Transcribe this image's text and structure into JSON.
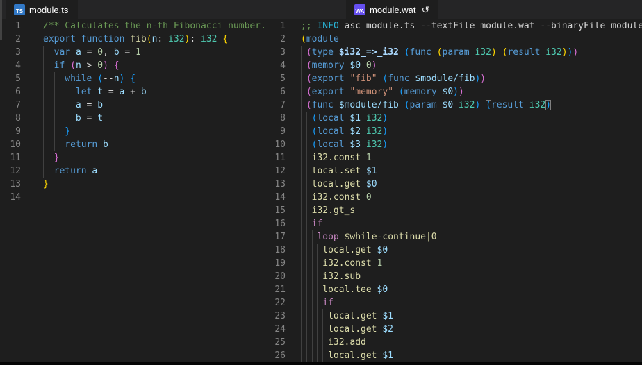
{
  "tabs": {
    "left": {
      "label": "module.ts",
      "icon_text": "TS",
      "icon_color": "#3178c6"
    },
    "right": {
      "label": "module.wat",
      "icon_text": "WA",
      "icon_color": "#654ff0",
      "reload_icon": "↺"
    }
  },
  "palette": {
    "kw": "#569cd6",
    "ctrl": "#c586c0",
    "fn": "#dcdcaa",
    "var": "#9cdcfe",
    "ent": "#abd9ff",
    "type": "#4ec9b0",
    "num": "#b5cea8",
    "str": "#ce9178",
    "cmt": "#6a9955",
    "info": "#29b8db",
    "txt": "#d4d4d4",
    "b1": "#ffd700",
    "b2": "#da70d6",
    "b3": "#179fff",
    "b3m": "#179fff",
    "line_number": "#858585",
    "editor_bg": "#1e1e1e",
    "tabbar_bg": "#252526"
  },
  "left_editor": {
    "language": "typescript",
    "lines": [
      {
        "n": 1,
        "ind": 0,
        "guides": [],
        "tokens": [
          [
            "cmt",
            "/** Calculates the n-th Fibonacci number."
          ]
        ]
      },
      {
        "n": 2,
        "ind": 0,
        "guides": [],
        "tokens": [
          [
            "kw",
            "export"
          ],
          [
            "txt",
            " "
          ],
          [
            "kw",
            "function"
          ],
          [
            "txt",
            " "
          ],
          [
            "fn",
            "fib"
          ],
          [
            "b1",
            "("
          ],
          [
            "var",
            "n"
          ],
          [
            "txt",
            ": "
          ],
          [
            "type",
            "i32"
          ],
          [
            "b1",
            ")"
          ],
          [
            "txt",
            ": "
          ],
          [
            "type",
            "i32"
          ],
          [
            "txt",
            " "
          ],
          [
            "b1",
            "{"
          ]
        ]
      },
      {
        "n": 3,
        "ind": 2,
        "guides": [
          0
        ],
        "tokens": [
          [
            "kw",
            "var"
          ],
          [
            "txt",
            " "
          ],
          [
            "var",
            "a"
          ],
          [
            "txt",
            " = "
          ],
          [
            "num",
            "0"
          ],
          [
            "txt",
            ", "
          ],
          [
            "var",
            "b"
          ],
          [
            "txt",
            " = "
          ],
          [
            "num",
            "1"
          ]
        ]
      },
      {
        "n": 4,
        "ind": 2,
        "guides": [
          0
        ],
        "tokens": [
          [
            "kw",
            "if"
          ],
          [
            "txt",
            " "
          ],
          [
            "b2",
            "("
          ],
          [
            "var",
            "n"
          ],
          [
            "txt",
            " > "
          ],
          [
            "num",
            "0"
          ],
          [
            "b2",
            ")"
          ],
          [
            "txt",
            " "
          ],
          [
            "b2",
            "{"
          ]
        ]
      },
      {
        "n": 5,
        "ind": 4,
        "guides": [
          0,
          2
        ],
        "tokens": [
          [
            "kw",
            "while"
          ],
          [
            "txt",
            " "
          ],
          [
            "b3",
            "("
          ],
          [
            "txt",
            "--"
          ],
          [
            "var",
            "n"
          ],
          [
            "b3",
            ")"
          ],
          [
            "txt",
            " "
          ],
          [
            "b3",
            "{"
          ]
        ]
      },
      {
        "n": 6,
        "ind": 6,
        "guides": [
          0,
          2,
          4
        ],
        "tokens": [
          [
            "kw",
            "let"
          ],
          [
            "txt",
            " "
          ],
          [
            "var",
            "t"
          ],
          [
            "txt",
            " = "
          ],
          [
            "var",
            "a"
          ],
          [
            "txt",
            " + "
          ],
          [
            "var",
            "b"
          ]
        ]
      },
      {
        "n": 7,
        "ind": 6,
        "guides": [
          0,
          2,
          4
        ],
        "tokens": [
          [
            "var",
            "a"
          ],
          [
            "txt",
            " = "
          ],
          [
            "var",
            "b"
          ]
        ]
      },
      {
        "n": 8,
        "ind": 6,
        "guides": [
          0,
          2,
          4
        ],
        "tokens": [
          [
            "var",
            "b"
          ],
          [
            "txt",
            " = "
          ],
          [
            "var",
            "t"
          ]
        ]
      },
      {
        "n": 9,
        "ind": 4,
        "guides": [
          0,
          2
        ],
        "tokens": [
          [
            "b3",
            "}"
          ]
        ]
      },
      {
        "n": 10,
        "ind": 4,
        "guides": [
          0,
          2
        ],
        "tokens": [
          [
            "kw",
            "return"
          ],
          [
            "txt",
            " "
          ],
          [
            "var",
            "b"
          ]
        ]
      },
      {
        "n": 11,
        "ind": 2,
        "guides": [
          0
        ],
        "tokens": [
          [
            "b2",
            "}"
          ]
        ]
      },
      {
        "n": 12,
        "ind": 2,
        "guides": [
          0
        ],
        "tokens": [
          [
            "kw",
            "return"
          ],
          [
            "txt",
            " "
          ],
          [
            "var",
            "a"
          ]
        ]
      },
      {
        "n": 13,
        "ind": 0,
        "guides": [],
        "tokens": [
          [
            "b1",
            "}"
          ]
        ]
      },
      {
        "n": 14,
        "ind": 0,
        "guides": [],
        "tokens": []
      }
    ]
  },
  "right_editor": {
    "language": "wat",
    "lines": [
      {
        "n": 1,
        "ind": 0,
        "guides": [],
        "tokens": [
          [
            "cmt",
            ";; "
          ],
          [
            "info",
            "INFO"
          ],
          [
            "txt",
            " asc module.ts --textFile module.wat --binaryFile module"
          ]
        ]
      },
      {
        "n": 2,
        "ind": 0,
        "guides": [],
        "tokens": [
          [
            "b1",
            "("
          ],
          [
            "kw",
            "module"
          ]
        ]
      },
      {
        "n": 3,
        "ind": 1,
        "guides": [
          0
        ],
        "tokens": [
          [
            "b2",
            "("
          ],
          [
            "kw",
            "type"
          ],
          [
            "txt",
            " "
          ],
          [
            "ent",
            "$i32_=>_i32"
          ],
          [
            "txt",
            " "
          ],
          [
            "b3",
            "("
          ],
          [
            "kw",
            "func"
          ],
          [
            "txt",
            " "
          ],
          [
            "b1",
            "("
          ],
          [
            "kw",
            "param"
          ],
          [
            "txt",
            " "
          ],
          [
            "type",
            "i32"
          ],
          [
            "b1",
            ")"
          ],
          [
            "txt",
            " "
          ],
          [
            "b1",
            "("
          ],
          [
            "kw",
            "result"
          ],
          [
            "txt",
            " "
          ],
          [
            "type",
            "i32"
          ],
          [
            "b1",
            ")"
          ],
          [
            "b3",
            ")"
          ],
          [
            "b2",
            ")"
          ]
        ]
      },
      {
        "n": 4,
        "ind": 1,
        "guides": [
          0
        ],
        "tokens": [
          [
            "b2",
            "("
          ],
          [
            "kw",
            "memory"
          ],
          [
            "txt",
            " "
          ],
          [
            "var",
            "$0"
          ],
          [
            "txt",
            " "
          ],
          [
            "num",
            "0"
          ],
          [
            "b2",
            ")"
          ]
        ]
      },
      {
        "n": 5,
        "ind": 1,
        "guides": [
          0
        ],
        "tokens": [
          [
            "b2",
            "("
          ],
          [
            "kw",
            "export"
          ],
          [
            "txt",
            " "
          ],
          [
            "str",
            "\"fib\""
          ],
          [
            "txt",
            " "
          ],
          [
            "b3",
            "("
          ],
          [
            "kw",
            "func"
          ],
          [
            "txt",
            " "
          ],
          [
            "var",
            "$module/fib"
          ],
          [
            "b3",
            ")"
          ],
          [
            "b2",
            ")"
          ]
        ]
      },
      {
        "n": 6,
        "ind": 1,
        "guides": [
          0
        ],
        "tokens": [
          [
            "b2",
            "("
          ],
          [
            "kw",
            "export"
          ],
          [
            "txt",
            " "
          ],
          [
            "str",
            "\"memory\""
          ],
          [
            "txt",
            " "
          ],
          [
            "b3",
            "("
          ],
          [
            "kw",
            "memory"
          ],
          [
            "txt",
            " "
          ],
          [
            "var",
            "$0"
          ],
          [
            "b3",
            ")"
          ],
          [
            "b2",
            ")"
          ]
        ]
      },
      {
        "n": 7,
        "ind": 1,
        "guides": [
          0
        ],
        "tokens": [
          [
            "b2",
            "("
          ],
          [
            "kw",
            "func"
          ],
          [
            "txt",
            " "
          ],
          [
            "var",
            "$module/fib"
          ],
          [
            "txt",
            " "
          ],
          [
            "b3",
            "("
          ],
          [
            "kw",
            "param"
          ],
          [
            "txt",
            " "
          ],
          [
            "var",
            "$0"
          ],
          [
            "txt",
            " "
          ],
          [
            "type",
            "i32"
          ],
          [
            "b3",
            ")"
          ],
          [
            "txt",
            " "
          ],
          [
            "b3m",
            "("
          ],
          [
            "kw",
            "result"
          ],
          [
            "txt",
            " "
          ],
          [
            "type",
            "i32"
          ],
          [
            "b3m",
            ")"
          ]
        ]
      },
      {
        "n": 8,
        "ind": 2,
        "guides": [
          0,
          1
        ],
        "tokens": [
          [
            "b3",
            "("
          ],
          [
            "kw",
            "local"
          ],
          [
            "txt",
            " "
          ],
          [
            "var",
            "$1"
          ],
          [
            "txt",
            " "
          ],
          [
            "type",
            "i32"
          ],
          [
            "b3",
            ")"
          ]
        ]
      },
      {
        "n": 9,
        "ind": 2,
        "guides": [
          0,
          1
        ],
        "tokens": [
          [
            "b3",
            "("
          ],
          [
            "kw",
            "local"
          ],
          [
            "txt",
            " "
          ],
          [
            "var",
            "$2"
          ],
          [
            "txt",
            " "
          ],
          [
            "type",
            "i32"
          ],
          [
            "b3",
            ")"
          ]
        ]
      },
      {
        "n": 10,
        "ind": 2,
        "guides": [
          0,
          1
        ],
        "tokens": [
          [
            "b3",
            "("
          ],
          [
            "kw",
            "local"
          ],
          [
            "txt",
            " "
          ],
          [
            "var",
            "$3"
          ],
          [
            "txt",
            " "
          ],
          [
            "type",
            "i32"
          ],
          [
            "b3",
            ")"
          ]
        ]
      },
      {
        "n": 11,
        "ind": 2,
        "guides": [
          0,
          1
        ],
        "tokens": [
          [
            "fn",
            "i32.const"
          ],
          [
            "txt",
            " "
          ],
          [
            "num",
            "1"
          ]
        ]
      },
      {
        "n": 12,
        "ind": 2,
        "guides": [
          0,
          1
        ],
        "tokens": [
          [
            "fn",
            "local.set"
          ],
          [
            "txt",
            " "
          ],
          [
            "var",
            "$1"
          ]
        ]
      },
      {
        "n": 13,
        "ind": 2,
        "guides": [
          0,
          1
        ],
        "tokens": [
          [
            "fn",
            "local.get"
          ],
          [
            "txt",
            " "
          ],
          [
            "var",
            "$0"
          ]
        ]
      },
      {
        "n": 14,
        "ind": 2,
        "guides": [
          0,
          1
        ],
        "tokens": [
          [
            "fn",
            "i32.const"
          ],
          [
            "txt",
            " "
          ],
          [
            "num",
            "0"
          ]
        ]
      },
      {
        "n": 15,
        "ind": 2,
        "guides": [
          0,
          1
        ],
        "tokens": [
          [
            "fn",
            "i32.gt_s"
          ]
        ]
      },
      {
        "n": 16,
        "ind": 2,
        "guides": [
          0,
          1
        ],
        "tokens": [
          [
            "ctrl",
            "if"
          ]
        ]
      },
      {
        "n": 17,
        "ind": 3,
        "guides": [
          0,
          1,
          2
        ],
        "tokens": [
          [
            "ctrl",
            "loop"
          ],
          [
            "txt",
            " "
          ],
          [
            "fn",
            "$while-continue|0"
          ]
        ]
      },
      {
        "n": 18,
        "ind": 4,
        "guides": [
          0,
          1,
          2,
          3
        ],
        "tokens": [
          [
            "fn",
            "local.get"
          ],
          [
            "txt",
            " "
          ],
          [
            "var",
            "$0"
          ]
        ]
      },
      {
        "n": 19,
        "ind": 4,
        "guides": [
          0,
          1,
          2,
          3
        ],
        "tokens": [
          [
            "fn",
            "i32.const"
          ],
          [
            "txt",
            " "
          ],
          [
            "num",
            "1"
          ]
        ]
      },
      {
        "n": 20,
        "ind": 4,
        "guides": [
          0,
          1,
          2,
          3
        ],
        "tokens": [
          [
            "fn",
            "i32.sub"
          ]
        ]
      },
      {
        "n": 21,
        "ind": 4,
        "guides": [
          0,
          1,
          2,
          3
        ],
        "tokens": [
          [
            "fn",
            "local.tee"
          ],
          [
            "txt",
            " "
          ],
          [
            "var",
            "$0"
          ]
        ]
      },
      {
        "n": 22,
        "ind": 4,
        "guides": [
          0,
          1,
          2,
          3
        ],
        "tokens": [
          [
            "ctrl",
            "if"
          ]
        ]
      },
      {
        "n": 23,
        "ind": 5,
        "guides": [
          0,
          1,
          2,
          3,
          4
        ],
        "tokens": [
          [
            "fn",
            "local.get"
          ],
          [
            "txt",
            " "
          ],
          [
            "var",
            "$1"
          ]
        ]
      },
      {
        "n": 24,
        "ind": 5,
        "guides": [
          0,
          1,
          2,
          3,
          4
        ],
        "tokens": [
          [
            "fn",
            "local.get"
          ],
          [
            "txt",
            " "
          ],
          [
            "var",
            "$2"
          ]
        ]
      },
      {
        "n": 25,
        "ind": 5,
        "guides": [
          0,
          1,
          2,
          3,
          4
        ],
        "tokens": [
          [
            "fn",
            "i32.add"
          ]
        ]
      },
      {
        "n": 26,
        "ind": 5,
        "guides": [
          0,
          1,
          2,
          3,
          4
        ],
        "tokens": [
          [
            "fn",
            "local.get"
          ],
          [
            "txt",
            " "
          ],
          [
            "var",
            "$1"
          ]
        ]
      }
    ]
  }
}
